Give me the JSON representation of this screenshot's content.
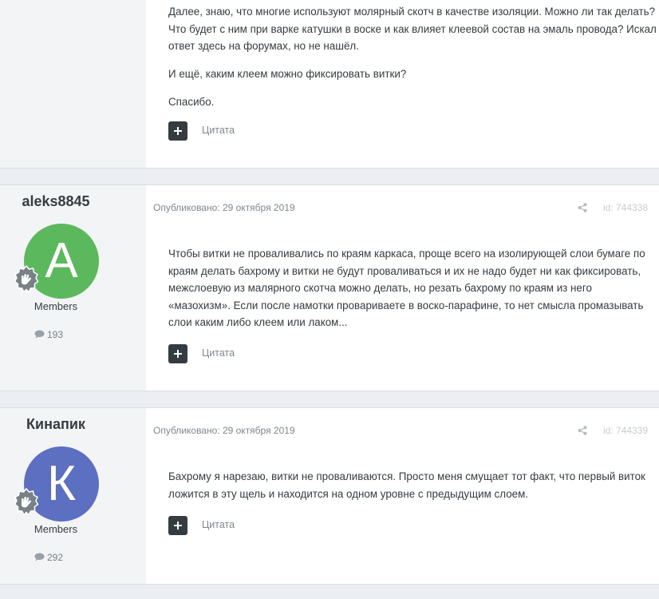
{
  "colors": {
    "page_bg": "#ebeef2",
    "avatar_a": "#5cb85c",
    "avatar_k": "#5c6fc1",
    "button": "#353c41"
  },
  "posts": [
    {
      "paragraphs": [
        "Далее, знаю, что многие используют молярный скотч в качестве изоляции. Можно ли так делать? Что будет с ним при варке катушки в воске и как влияет клеевой состав на эмаль провода? Искал ответ здесь на форумах, но не нашёл.",
        "И ещё, каким клеем можно фиксировать витки?",
        "Спасибо."
      ],
      "quote_label": "Цитата"
    },
    {
      "author": "aleks8845",
      "avatar_letter": "A",
      "group": "Members",
      "post_count": "193",
      "published": "Опубликовано: 29 октября 2019",
      "post_id": "id: 744338",
      "paragraphs": [
        "Чтобы витки не проваливались по краям каркаса, проще всего на изолирующей слои бумаге по краям делать бахрому и витки не будут проваливаться и их не надо будет ни как фиксировать, межслоевую из малярного скотча можно делать, но резать бахрому по краям из него «мазохизм». Если после намотки провариваете в воско-парафине, то нет смысла промазывать слои каким либо клеем или лаком..."
      ],
      "quote_label": "Цитата"
    },
    {
      "author": "Кинапик",
      "avatar_letter": "К",
      "group": "Members",
      "post_count": "292",
      "published": "Опубликовано: 29 октября 2019",
      "post_id": "id: 744339",
      "paragraphs": [
        "Бахрому я нарезаю, витки не проваливаются. Просто меня смущает тот факт, что первый виток ложится в эту щель и находится на одном уровне с предыдущим слоем."
      ],
      "quote_label": "Цитата"
    }
  ],
  "icons": {
    "share": "share-icon",
    "comment": "comment-icon",
    "badge": "hand-badge-icon",
    "plus": "plus-icon"
  }
}
